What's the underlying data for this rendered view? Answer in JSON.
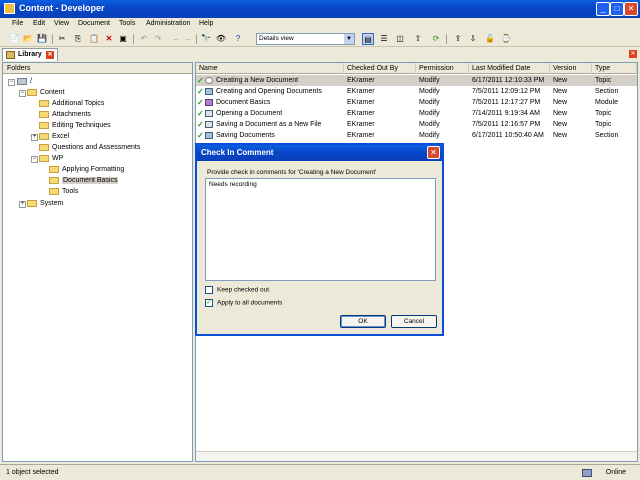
{
  "window": {
    "title": "Content - Developer"
  },
  "menu": [
    "File",
    "Edit",
    "View",
    "Document",
    "Tools",
    "Administration",
    "Help"
  ],
  "toolbar": {
    "view_select": "Details view"
  },
  "tab": {
    "label": "Library"
  },
  "folders": {
    "header": "Folders",
    "items": [
      {
        "label": "/"
      },
      {
        "label": "Content"
      },
      {
        "label": "Additional Topics"
      },
      {
        "label": "Attachments"
      },
      {
        "label": "Editing Techniques"
      },
      {
        "label": "Excel"
      },
      {
        "label": "Questions and Assessments"
      },
      {
        "label": "WP"
      },
      {
        "label": "Applying Formatting"
      },
      {
        "label": "Document Basics"
      },
      {
        "label": "Tools"
      },
      {
        "label": "System"
      }
    ]
  },
  "list": {
    "columns": [
      "Name",
      "Checked Out By",
      "Permission",
      "Last Modified Date",
      "Version",
      "Type"
    ],
    "rows": [
      {
        "name": "Creating a New Document",
        "checked_out_by": "EKramer",
        "permission": "Modify",
        "modified": "6/17/2011 12:10:33 PM",
        "version": "New",
        "type": "Topic"
      },
      {
        "name": "Creating and Opening Documents",
        "checked_out_by": "EKramer",
        "permission": "Modify",
        "modified": "7/5/2011 12:09:12 PM",
        "version": "New",
        "type": "Section"
      },
      {
        "name": "Document Basics",
        "checked_out_by": "EKramer",
        "permission": "Modify",
        "modified": "7/5/2011 12:17:27 PM",
        "version": "New",
        "type": "Module"
      },
      {
        "name": "Opening a Document",
        "checked_out_by": "EKramer",
        "permission": "Modify",
        "modified": "7/14/2011 9:19:34 AM",
        "version": "New",
        "type": "Topic"
      },
      {
        "name": "Saving a Document as a New File",
        "checked_out_by": "EKramer",
        "permission": "Modify",
        "modified": "7/5/2011 12:16:57 PM",
        "version": "New",
        "type": "Topic"
      },
      {
        "name": "Saving Documents",
        "checked_out_by": "EKramer",
        "permission": "Modify",
        "modified": "6/17/2011 10:50:40 AM",
        "version": "New",
        "type": "Section"
      }
    ]
  },
  "dialog": {
    "title": "Check In Comment",
    "prompt": "Provide check in comments for 'Creating a New Document'",
    "comment": "Needs recording",
    "keep_checked_out": "Keep checked out",
    "apply_all": "Apply to all documents",
    "ok": "OK",
    "cancel": "Cancel"
  },
  "status": {
    "left": "1 object selected",
    "right": "Online"
  }
}
